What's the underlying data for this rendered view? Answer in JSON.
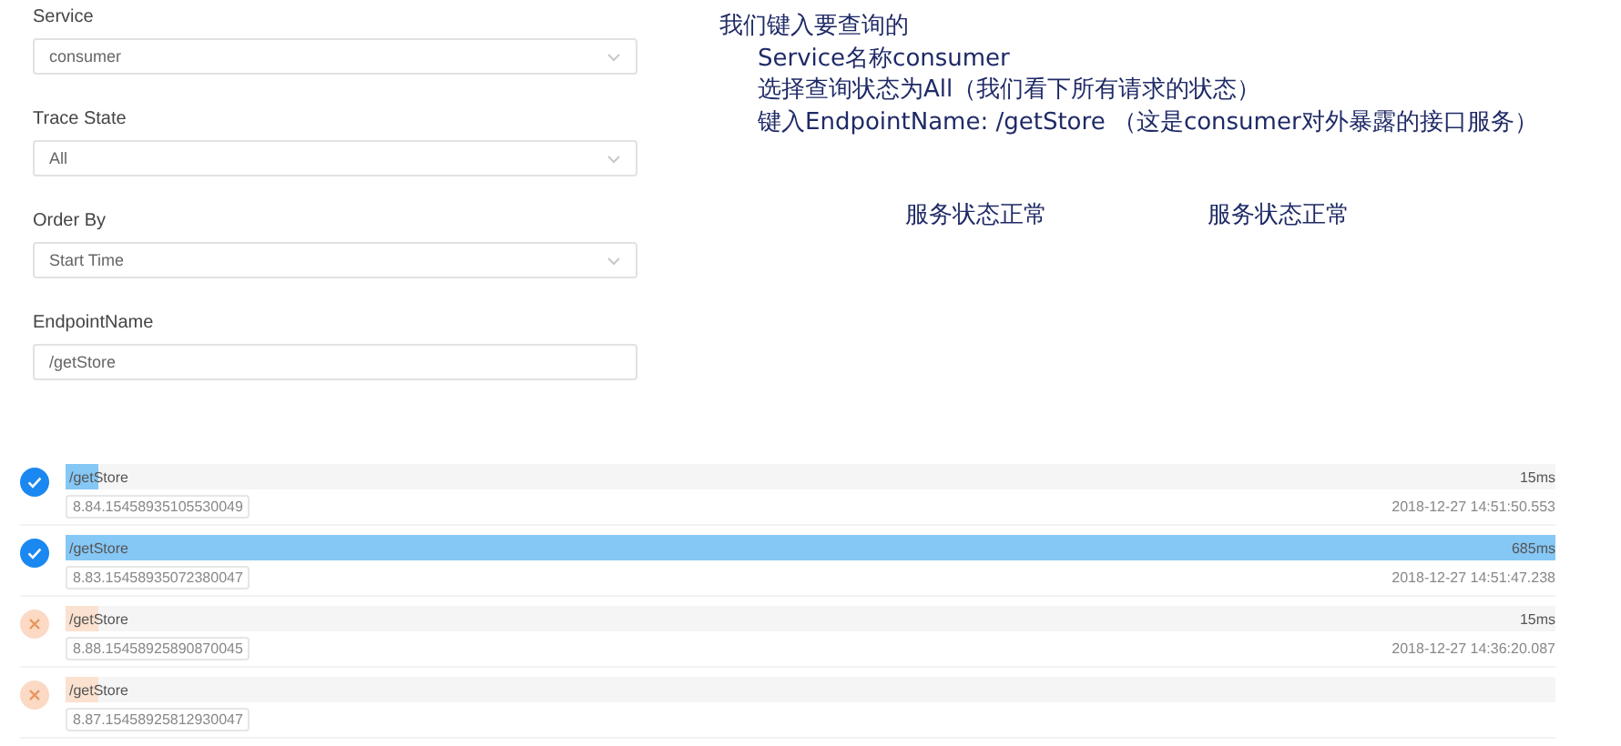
{
  "filters": [
    {
      "label": "Service",
      "kind": "select",
      "value": "consumer"
    },
    {
      "label": "Trace State",
      "kind": "select",
      "value": "All"
    },
    {
      "label": "Order By",
      "kind": "select",
      "value": "Start Time"
    },
    {
      "label": "EndpointName",
      "kind": "input",
      "value": "/getStore"
    }
  ],
  "annotation": {
    "lines": [
      "我们键入要查询的",
      "Service名称consumer",
      "选择查询状态为All（我们看下所有请求的状态）",
      "键入EndpointName: /getStore （这是consumer对外暴露的接口服务）"
    ],
    "notes": [
      "服务状态正常",
      "服务状态正常"
    ]
  },
  "traces": [
    {
      "endpoint": "/getStore",
      "error": false,
      "level": 0.022,
      "duration": "15ms",
      "trace_id": "8.84.15458935105530049",
      "time": "2018-12-27 14:51:50.553"
    },
    {
      "endpoint": "/getStore",
      "error": false,
      "level": 1,
      "duration": "685ms",
      "trace_id": "8.83.15458935072380047",
      "time": "2018-12-27 14:51:47.238"
    },
    {
      "endpoint": "/getStore",
      "error": true,
      "level": 0.022,
      "duration": "15ms",
      "trace_id": "8.88.15458925890870045",
      "time": "2018-12-27 14:36:20.087"
    },
    {
      "endpoint": "/getStore",
      "error": true,
      "level": 0.022,
      "trace_id": "8.87.15458925812930047"
    }
  ]
}
